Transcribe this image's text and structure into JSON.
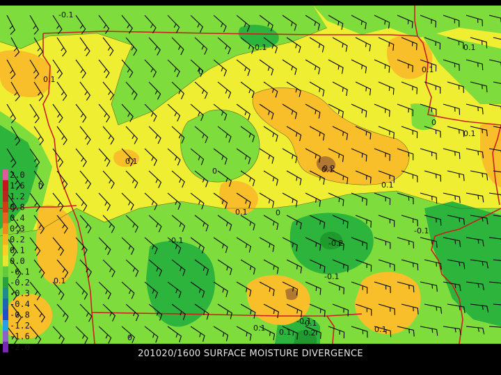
{
  "title": "201020/1600 SURFACE MOISTURE DIVERGENCE",
  "colors": {
    "background": "#000000",
    "base_yellow": "#f0ee32",
    "light_green": "#7edc3c",
    "mid_green": "#2cb43c",
    "dark_green": "#1f9a2c",
    "orange": "#f9bf2a",
    "brown": "#b07830",
    "border_red": "#c81e1e",
    "barb": "#000000"
  },
  "legend": {
    "labels": [
      "2.0",
      "1.6",
      "1.2",
      "0.8",
      "0.4",
      "0.3",
      "0.2",
      "0.1",
      "0.0",
      "-0.1",
      "-0.2",
      "-0.3",
      "-0.4",
      "-0.8",
      "-1.2",
      "-1.6",
      "-2.0"
    ],
    "colors": [
      "#e05a9e",
      "#c8141e",
      "#b4281e",
      "#d23c14",
      "#e6641e",
      "#f08c1e",
      "#f4b41e",
      "#f9d028",
      "#e6e632",
      "#64c83c",
      "#28a03c",
      "#1e8c8c",
      "#1e64b4",
      "#1e50c8",
      "#28a0e6",
      "#8c64c8",
      "#7828b4"
    ]
  },
  "contour_labels": [
    "-0.1",
    "-0.1",
    "0.1",
    "0",
    "0.1",
    "-0.1",
    "0",
    "0.1",
    "0.1",
    "0",
    "0",
    "0.2",
    "0.1",
    "0.1",
    "0.1",
    "-0.1",
    "-0.1",
    "-0.2",
    "0.1",
    "-0.1",
    "0.1",
    "-0.1",
    "0.1",
    "0.1",
    "0",
    "0.2",
    "0.1",
    "0"
  ]
}
